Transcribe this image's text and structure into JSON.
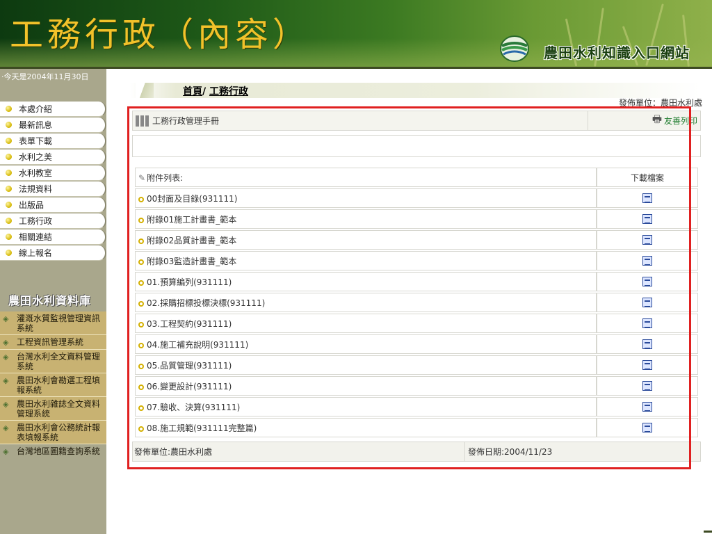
{
  "header": {
    "page_title": "工務行政（內容）",
    "site_name": "農田水利知識入口網站"
  },
  "sidebar": {
    "date_text": "‧今天是2004年11月30日",
    "menu": [
      {
        "label": "本處介紹"
      },
      {
        "label": "最新訊息"
      },
      {
        "label": "表單下載"
      },
      {
        "label": "水利之美"
      },
      {
        "label": "水利教室"
      },
      {
        "label": "法規資料"
      },
      {
        "label": "出版品"
      },
      {
        "label": "工務行政"
      },
      {
        "label": "相關連結"
      },
      {
        "label": "線上報名"
      }
    ],
    "database_title": "農田水利資料庫",
    "databases": [
      {
        "label": "灌溉水質監視管理資訊系統"
      },
      {
        "label": "工程資訊管理系統"
      },
      {
        "label": "台灣水利全文資料管理系統"
      },
      {
        "label": "農田水利會勘選工程填報系統"
      },
      {
        "label": "農田水利雜誌全文資料管理系統"
      },
      {
        "label": "農田水利會公務統計報表填報系統"
      },
      {
        "label": "台灣地區圖籍查詢系統"
      }
    ]
  },
  "main": {
    "breadcrumb": {
      "home": "首頁",
      "separator": "/",
      "current": "工務行政"
    },
    "publisher_top": "發佈單位：農田水利處",
    "doc_title": "工務行政管理手冊",
    "print_label": "友善列印",
    "attachments_header": "附件列表:",
    "download_header": "下載檔案",
    "attachments": [
      {
        "name": "00封面及目錄(931111)"
      },
      {
        "name": "附錄01施工計畫書_範本"
      },
      {
        "name": "附錄02品質計畫書_範本"
      },
      {
        "name": "附錄03監造計畫書_範本"
      },
      {
        "name": "01.預算編列(931111)"
      },
      {
        "name": "02.採購招標投標決標(931111)"
      },
      {
        "name": "03.工程契約(931111)"
      },
      {
        "name": "04.施工補充說明(931111)"
      },
      {
        "name": "05.品質管理(931111)"
      },
      {
        "name": "06.變更設計(931111)"
      },
      {
        "name": "07.驗收、決算(931111)"
      },
      {
        "name": "08.施工規範(931111完整篇)"
      }
    ],
    "footer_publisher": "發佈單位:農田水利處",
    "footer_date": "發佈日期:2004/11/23"
  },
  "colors": {
    "title_gold": "#f2c22a",
    "sidebar_bg": "#a9a78c",
    "db_item_bg": "#c8b272",
    "highlight_red": "#e02020",
    "print_green": "#1a7a2a"
  }
}
